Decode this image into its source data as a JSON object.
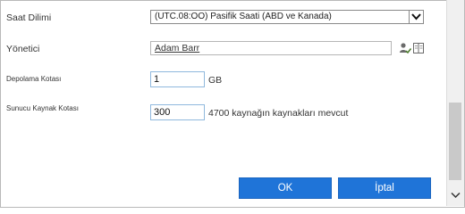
{
  "fields": {
    "timezone": {
      "label": "Saat Dilimi",
      "value": "(UTC.08:OO) Pasifik Saati (ABD ve Kanada)"
    },
    "administrator": {
      "label": "Yönetici",
      "value": "Adam Barr"
    },
    "storage_quota": {
      "label": "Depolama Kotası",
      "value": "1",
      "unit": "GB"
    },
    "server_resource_quota": {
      "label": "Sunucu Kaynak Kotası",
      "value": "300",
      "suffix": "4700 kaynağın kaynakları mevcut"
    }
  },
  "buttons": {
    "ok": "OK",
    "cancel": "İptal"
  },
  "icons": {
    "check_names": "check-names-icon",
    "browse": "address-book-icon",
    "dropdown": "chevron-down-icon",
    "scroll_down": "scroll-down-arrow-icon"
  },
  "colors": {
    "button": "#1f74d8",
    "input_border": "#8fb8dd"
  }
}
